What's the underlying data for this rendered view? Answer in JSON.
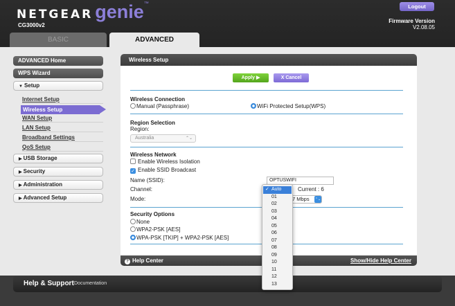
{
  "header": {
    "brand_name": "NETGEAR",
    "brand_product": "genie",
    "brand_tm": "™",
    "model": "CG3000v2",
    "logout_label": "Logout",
    "firmware_label": "Firmware Version",
    "firmware_value": "V2.08.05",
    "tabs": [
      {
        "label": "BASIC",
        "active": false
      },
      {
        "label": "ADVANCED",
        "active": true
      }
    ]
  },
  "sidebar": {
    "advanced_home": "ADVANCED Home",
    "wps_wizard": "WPS Wizard",
    "setup": "Setup",
    "setup_items": [
      "Internet Setup",
      "Wireless Setup",
      "WAN Setup",
      "LAN Setup",
      "Broadband Settings",
      "QoS Setup"
    ],
    "active_item": "Wireless Setup",
    "usb_storage": "USB Storage",
    "security": "Security",
    "administration": "Administration",
    "advanced_setup": "Advanced Setup"
  },
  "panel": {
    "title": "Wireless Setup",
    "apply_label": "Apply ▶",
    "cancel_label": "X Cancel",
    "wireless_connection": {
      "title": "Wireless Connection",
      "manual_label": "Manual (Passphrase)",
      "wps_label": "WiFi Protected Setup(WPS)",
      "selected": "WiFi Protected Setup(WPS)"
    },
    "region": {
      "title": "Region Selection",
      "label": "Region:",
      "value": "Australia"
    },
    "network": {
      "title": "Wireless Network",
      "isolation_label": "Enable Wireless Isolation",
      "isolation_checked": false,
      "broadcast_label": "Enable SSID Broadcast",
      "broadcast_checked": true,
      "ssid_label": "Name (SSID):",
      "ssid_value": "OPTUSWIFI",
      "channel_label": "Channel:",
      "current_label": "Current : 6",
      "mode_label": "Mode:",
      "mode_value": "7 Mbps"
    },
    "security": {
      "title": "Security Options",
      "options": [
        "None",
        "WPA2-PSK [AES]",
        "WPA-PSK [TKIP] + WPA2-PSK [AES]"
      ],
      "selected": "WPA-PSK [TKIP] + WPA2-PSK [AES]"
    },
    "help_center": "Help Center",
    "show_hide": "Show/Hide Help Center"
  },
  "channel_dropdown": {
    "selected": "Auto",
    "check": "✓",
    "options": [
      "Auto",
      "01",
      "02",
      "03",
      "04",
      "05",
      "06",
      "07",
      "08",
      "09",
      "10",
      "11",
      "12",
      "13"
    ]
  },
  "footer": {
    "title": "Help & Support",
    "documentation": "Documentation"
  },
  "colors": {
    "accent_purple": "#7b6cd2",
    "apply_green": "#6ac22d",
    "rule_blue": "#5aa3d0",
    "select_blue": "#3a80d9"
  }
}
